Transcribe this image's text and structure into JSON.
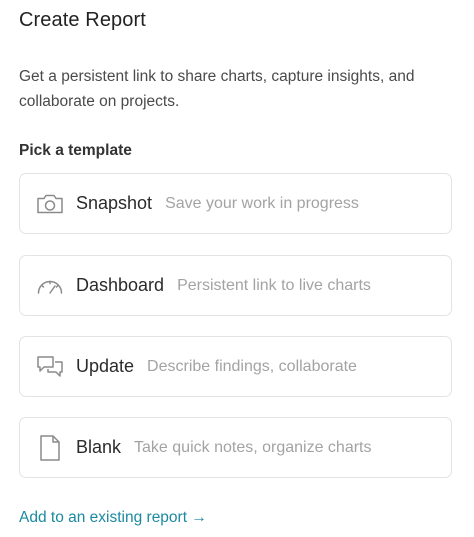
{
  "header": {
    "title": "Create Report",
    "description": "Get a persistent link to share charts, capture insights, and collaborate on projects."
  },
  "templates": {
    "label": "Pick a template",
    "items": [
      {
        "name": "Snapshot",
        "description": "Save your work in progress",
        "icon": "camera-icon"
      },
      {
        "name": "Dashboard",
        "description": "Persistent link to live charts",
        "icon": "gauge-icon"
      },
      {
        "name": "Update",
        "description": "Describe findings, collaborate",
        "icon": "chat-bubbles-icon"
      },
      {
        "name": "Blank",
        "description": "Take quick notes, organize charts",
        "icon": "document-icon"
      }
    ]
  },
  "footer": {
    "add_existing_link": "Add to an existing report →"
  },
  "colors": {
    "link": "#1b8aa0",
    "muted_text": "#a3a3a3",
    "border": "#e3e3e3"
  }
}
